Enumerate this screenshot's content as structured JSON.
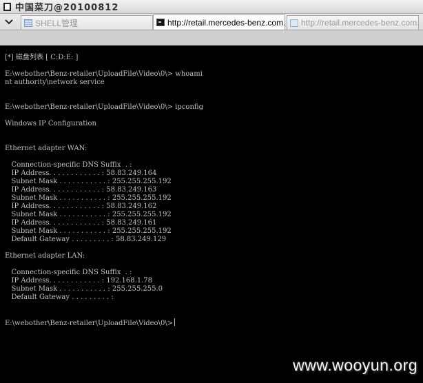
{
  "window": {
    "title": "中国菜刀@20100812"
  },
  "tabs": [
    {
      "label": "SHELL管理",
      "icon": "shell-list-icon",
      "state": "inactive"
    },
    {
      "label": "http://retail.mercedes-benz.com....",
      "icon": "terminal-icon",
      "state": "active"
    },
    {
      "label": "http://retail.mercedes-benz.com....",
      "icon": "folder-icon",
      "state": "inactive"
    }
  ],
  "terminal": {
    "lines": [
      "[*] 磁盘列表 [ C:D:E: ]",
      "",
      "E:\\webother\\Benz-retailer\\UploadFile\\Video\\0\\> whoami",
      "nt authority\\network service",
      "",
      "",
      "E:\\webother\\Benz-retailer\\UploadFile\\Video\\0\\> ipconfig",
      "",
      "Windows IP Configuration",
      "",
      "",
      "Ethernet adapter WAN:",
      "",
      "   Connection-specific DNS Suffix  . :",
      "   IP Address. . . . . . . . . . . . : 58.83.249.164",
      "   Subnet Mask . . . . . . . . . . . : 255.255.255.192",
      "   IP Address. . . . . . . . . . . . : 58.83.249.163",
      "   Subnet Mask . . . . . . . . . . . : 255.255.255.192",
      "   IP Address. . . . . . . . . . . . : 58.83.249.162",
      "   Subnet Mask . . . . . . . . . . . : 255.255.255.192",
      "   IP Address. . . . . . . . . . . . : 58.83.249.161",
      "   Subnet Mask . . . . . . . . . . . : 255.255.255.192",
      "   Default Gateway . . . . . . . . . : 58.83.249.129",
      "",
      "Ethernet adapter LAN:",
      "",
      "   Connection-specific DNS Suffix  . :",
      "   IP Address. . . . . . . . . . . . : 192.168.1.78",
      "   Subnet Mask . . . . . . . . . . . : 255.255.255.0",
      "   Default Gateway . . . . . . . . . :",
      "",
      "",
      "E:\\webother\\Benz-retailer\\UploadFile\\Video\\0\\>"
    ]
  },
  "watermark": "www.wooyun.org"
}
